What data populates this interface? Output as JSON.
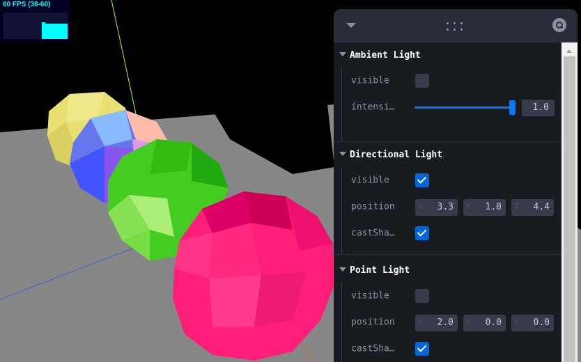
{
  "fps": {
    "label": "60 FPS (38-60)",
    "current": 60,
    "min": 38,
    "max": 60
  },
  "panel": {
    "folders": [
      {
        "title": "Ambient Light",
        "controls": {
          "visible": {
            "label": "visible",
            "checked": false
          },
          "intensity": {
            "label": "intensity",
            "value": "1.0",
            "fraction": 1.0
          }
        }
      },
      {
        "title": "Directional Light",
        "controls": {
          "visible": {
            "label": "visible",
            "checked": true
          },
          "position": {
            "label": "position",
            "x_label": "X",
            "x": "3.3",
            "y_label": "Y",
            "y": "1.0",
            "z_label": "Z",
            "z": "4.4"
          },
          "castShadow": {
            "label": "castShadow",
            "checked": true
          }
        }
      },
      {
        "title": "Point Light",
        "controls": {
          "visible": {
            "label": "visible",
            "checked": false
          },
          "position": {
            "label": "position",
            "x_label": "X",
            "x": "2.0",
            "y_label": "Y",
            "y": "0.0",
            "z_label": "Z",
            "z": "0.0"
          },
          "castShadow": {
            "label": "castShadow",
            "checked": true
          }
        }
      }
    ]
  },
  "colors": {
    "fps_text": "#00ffff",
    "panel_bg": "#181c20",
    "accent": "#007bff",
    "sphere_yellow": "#e8e070",
    "sphere_normal_blue": "#5566ff",
    "sphere_green": "#44cc22",
    "sphere_pink": "#ff1f7a",
    "floor": "#8a8a8a"
  },
  "icons": {
    "collapse": "chevron-down-icon",
    "drag": "drag-handle-icon",
    "search": "search-icon"
  }
}
